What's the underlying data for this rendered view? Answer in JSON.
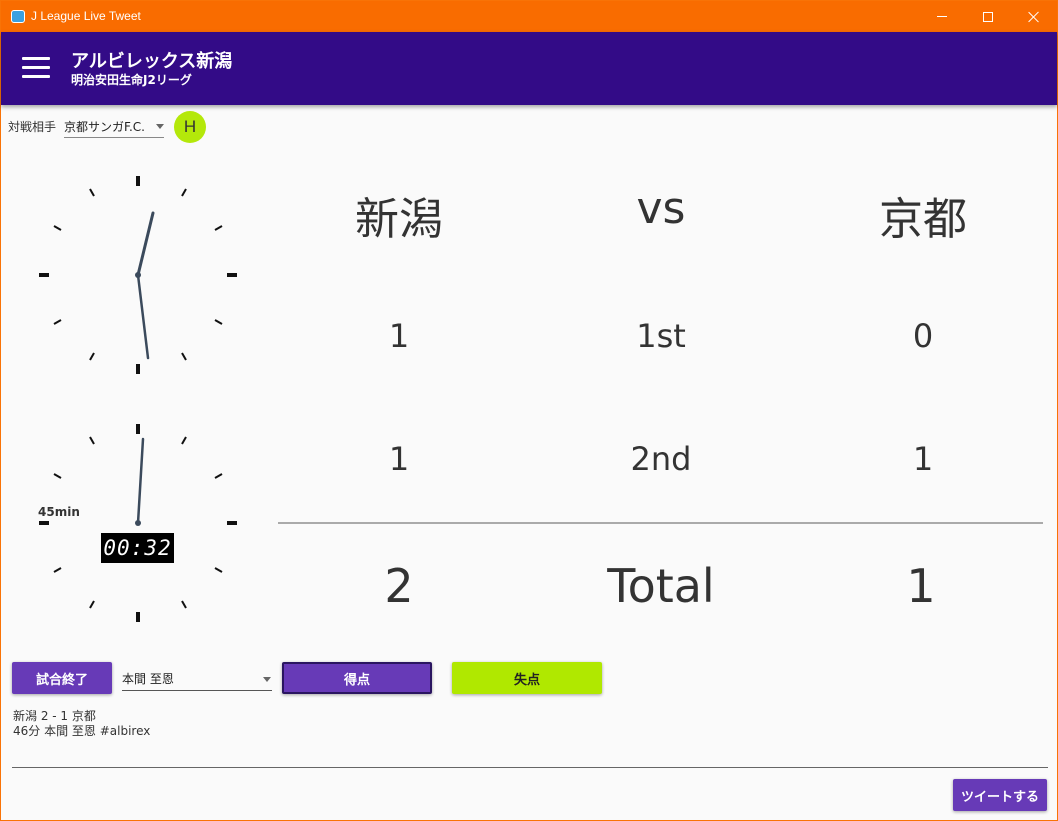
{
  "window": {
    "title": "J League Live Tweet"
  },
  "appbar": {
    "title": "アルビレックス新潟",
    "subtitle": "明治安田生命J2リーグ"
  },
  "opponent": {
    "label": "対戦相手",
    "value": "京都サンガF.C.",
    "home_away": "H"
  },
  "clock": {
    "elapsed_label": "45min",
    "digital_time": "00:32",
    "analog_hour_minute_hands_time": "12:32",
    "match_minute": 45
  },
  "scoreboard": {
    "home_team": "新潟",
    "vs": "vs",
    "away_team": "京都",
    "rows": [
      {
        "label": "1st",
        "home": "1",
        "away": "0"
      },
      {
        "label": "2nd",
        "home": "1",
        "away": "1"
      }
    ],
    "total": {
      "label": "Total",
      "home": "2",
      "away": "1"
    }
  },
  "controls": {
    "end_match_label": "試合終了",
    "player_value": "本間 至恩",
    "goal_label": "得点",
    "concede_label": "失点",
    "tweet_label": "ツイートする"
  },
  "tweet": {
    "line1": "新潟 2 - 1 京都",
    "line2": "46分 本間 至恩 #albirex"
  },
  "colors": {
    "titlebar": "#f96c00",
    "appbar": "#330b87",
    "primary_button": "#673ab7",
    "accent": "#b0e800"
  }
}
